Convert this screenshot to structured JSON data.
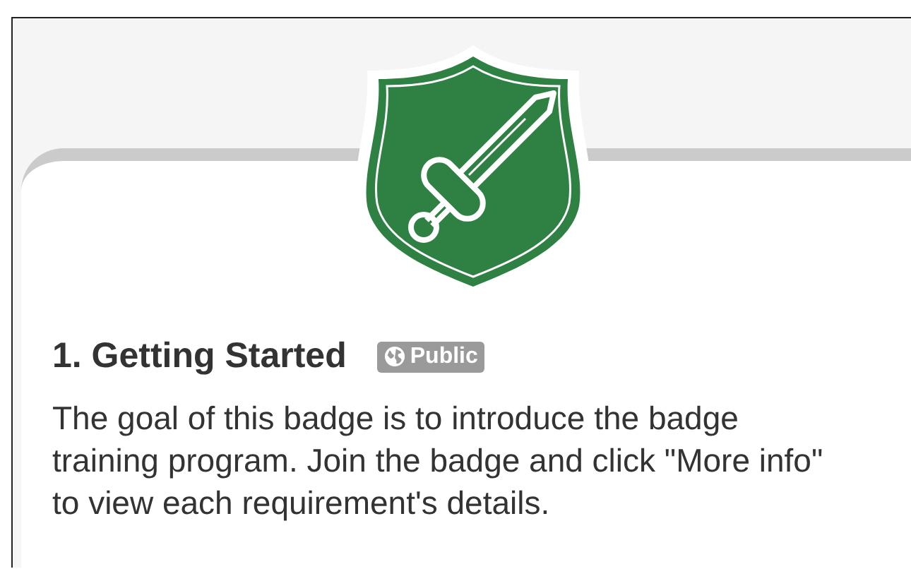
{
  "badge": {
    "title": "1. Getting Started",
    "visibility": {
      "kind": "public",
      "label": "Public"
    },
    "description": "The goal of this badge is to introduce the badge training program. Join the badge and click \"More info\" to view each requirement's details."
  }
}
